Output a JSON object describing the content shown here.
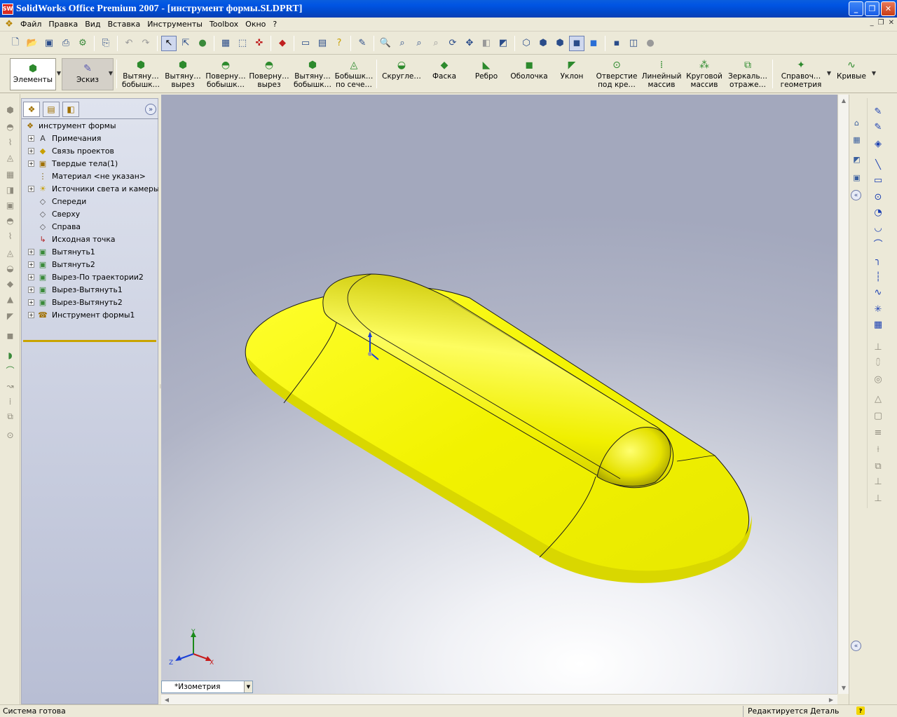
{
  "window": {
    "title": "SolidWorks Office Premium 2007 - [инструмент формы.SLDPRT]",
    "app_icon_text": "SW",
    "buttons": [
      "_",
      "❐",
      "✕"
    ]
  },
  "menu": {
    "items": [
      "Файл",
      "Правка",
      "Вид",
      "Вставка",
      "Инструменты",
      "Toolbox",
      "Окно",
      "?"
    ],
    "doc_buttons": [
      "_",
      "❐",
      "✕"
    ]
  },
  "command_manager": {
    "tabs": [
      {
        "label": "Элементы",
        "icon": "features-icon"
      },
      {
        "label": "Эскиз",
        "icon": "sketch-icon"
      }
    ],
    "commands": [
      {
        "line1": "Вытяну…",
        "line2": "бобышк…",
        "icon": "extruded-boss-icon"
      },
      {
        "line1": "Вытяну…",
        "line2": "вырез",
        "icon": "extruded-cut-icon"
      },
      {
        "line1": "Поверну…",
        "line2": "бобышк…",
        "icon": "revolved-boss-icon"
      },
      {
        "line1": "Поверну…",
        "line2": "вырез",
        "icon": "revolved-cut-icon"
      },
      {
        "line1": "Вытяну…",
        "line2": "бобышк…",
        "icon": "swept-boss-icon"
      },
      {
        "line1": "Бобышк…",
        "line2": "по сече…",
        "icon": "lofted-boss-icon"
      },
      {
        "line1": "Скругле…",
        "line2": "",
        "icon": "fillet-icon"
      },
      {
        "line1": "Фаска",
        "line2": "",
        "icon": "chamfer-icon"
      },
      {
        "line1": "Ребро",
        "line2": "",
        "icon": "rib-icon"
      },
      {
        "line1": "Оболочка",
        "line2": "",
        "icon": "shell-icon"
      },
      {
        "line1": "Уклон",
        "line2": "",
        "icon": "draft-icon"
      },
      {
        "line1": "Отверстие",
        "line2": "под кре…",
        "icon": "hole-wizard-icon"
      },
      {
        "line1": "Линейный",
        "line2": "массив",
        "icon": "linear-pattern-icon"
      },
      {
        "line1": "Круговой",
        "line2": "массив",
        "icon": "circular-pattern-icon"
      },
      {
        "line1": "Зеркаль…",
        "line2": "отраже…",
        "icon": "mirror-icon"
      },
      {
        "line1": "Справоч…",
        "line2": "геометрия",
        "icon": "reference-geometry-icon"
      },
      {
        "line1": "Кривые",
        "line2": "",
        "icon": "curves-icon"
      }
    ]
  },
  "feature_tree": {
    "root": "инструмент формы",
    "items": [
      {
        "label": "Примечания",
        "expandable": true,
        "icon": "annotations-icon"
      },
      {
        "label": "Связь проектов",
        "expandable": true,
        "icon": "design-binder-icon"
      },
      {
        "label": "Твердые тела(1)",
        "expandable": true,
        "icon": "solid-bodies-icon"
      },
      {
        "label": "Материал <не указан>",
        "expandable": false,
        "icon": "material-icon"
      },
      {
        "label": "Источники света и камеры",
        "expandable": true,
        "icon": "lights-icon"
      },
      {
        "label": "Спереди",
        "expandable": false,
        "icon": "plane-icon"
      },
      {
        "label": "Сверху",
        "expandable": false,
        "icon": "plane-icon"
      },
      {
        "label": "Справа",
        "expandable": false,
        "icon": "plane-icon"
      },
      {
        "label": "Исходная точка",
        "expandable": false,
        "icon": "origin-icon"
      },
      {
        "label": "Вытянуть1",
        "expandable": true,
        "icon": "extrude-feature-icon"
      },
      {
        "label": "Вытянуть2",
        "expandable": true,
        "icon": "extrude-feature-icon"
      },
      {
        "label": "Вырез-По траектории2",
        "expandable": true,
        "icon": "cut-sweep-icon"
      },
      {
        "label": "Вырез-Вытянуть1",
        "expandable": true,
        "icon": "cut-extrude-icon"
      },
      {
        "label": "Вырез-Вытянуть2",
        "expandable": true,
        "icon": "cut-extrude-icon"
      },
      {
        "label": "Инструмент формы1",
        "expandable": true,
        "icon": "forming-tool-icon"
      }
    ]
  },
  "viewport": {
    "view_orientation": "*Изометрия",
    "part_color": "#f2f200",
    "triad_labels": [
      "Y",
      "Z",
      "X"
    ]
  },
  "status": {
    "left": "Система готова",
    "right": "Редактируется Деталь",
    "help": "?"
  }
}
